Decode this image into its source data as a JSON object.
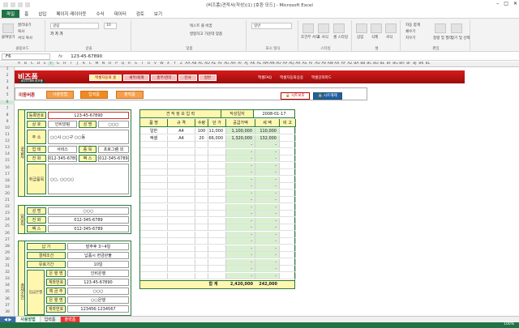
{
  "window": {
    "title": "(비즈폼)견적서(작성)(1) [호환 모드] - Microsoft Excel"
  },
  "ribbon_tabs": [
    "파일",
    "홈",
    "삽입",
    "페이지 레이아웃",
    "수식",
    "데이터",
    "검토",
    "보기"
  ],
  "ribbon": {
    "clipboard": {
      "paste": "붙여넣기",
      "cut": "잘라내기",
      "copy": "복사",
      "format_painter": "서식 복사",
      "label": "클립보드"
    },
    "font": {
      "font_name": "굴림",
      "font_size": "10",
      "label": "글꼴"
    },
    "alignment": {
      "wrap": "텍스트 줄 바꿈",
      "merge": "병합하고 가운데 맞춤",
      "label": "맞춤"
    },
    "number": {
      "format": "일반",
      "label": "표시 형식"
    },
    "styles": {
      "cond": "조건부 서식",
      "table": "표 서식",
      "cell": "셀 스타일",
      "label": "스타일"
    },
    "cells": {
      "insert": "삽입",
      "delete": "삭제",
      "format": "서식",
      "label": "셀"
    },
    "editing": {
      "autosum": "자동 합계",
      "fill": "채우기",
      "clear": "지우기",
      "sort": "정렬 및 필터",
      "find": "찾기 및 선택",
      "label": "편집"
    }
  },
  "formula_bar": {
    "name_box": "F6",
    "fx": "fx",
    "value": "123-45-67890"
  },
  "columns": [
    "A",
    "B",
    "C",
    "D",
    "E",
    "F",
    "G",
    "H",
    "I",
    "J",
    "K",
    "L",
    "M",
    "N",
    "O",
    "P",
    "Q",
    "R",
    "S",
    "T",
    "U",
    "V",
    "W",
    "X",
    "Y",
    "Z",
    "AA",
    "AB",
    "AC",
    "AD",
    "AE",
    "AF",
    "AG",
    "AH",
    "AI",
    "AJ",
    "AK",
    "AL",
    "AM",
    "AN",
    "AO",
    "AP",
    "AQ",
    "AR",
    "AS",
    "AT",
    "AU",
    "AV",
    "AW",
    "AX",
    "AY",
    "AZ",
    "BA",
    "BB",
    "BC",
    "BD",
    "BE",
    "BF",
    "BG",
    "BH",
    "BI",
    "BJ",
    "BK",
    "BL"
  ],
  "rows": [
    "1",
    "2",
    "3",
    "4",
    "5",
    "6",
    "7",
    "8",
    "9",
    "10",
    "11",
    "12",
    "13",
    "14",
    "15",
    "16",
    "17",
    "18",
    "19",
    "20",
    "21",
    "22",
    "23",
    "24",
    "25",
    "26",
    "27",
    "28",
    "29",
    "30",
    "31",
    "32",
    "33",
    "34",
    "35",
    "36",
    "37",
    "38"
  ],
  "banner": {
    "logo": "비즈폼",
    "sub": "BIZFORM 비즈폼",
    "nav": [
      "엑셀자동화 홈",
      "세무/회계",
      "총무/관리",
      "인사",
      "일반"
    ],
    "links": [
      "엑셀FAQ",
      "엑셀자동화응용",
      "엑셀강좌파드"
    ]
  },
  "toolbar": {
    "title": "이동버튼",
    "buttons": [
      "사용방법",
      "입력폼",
      "출력폼"
    ],
    "print_preview": "시트보호",
    "unprotect": "시트해제"
  },
  "supplier": {
    "section": "공급자",
    "reg_label": "등록번호",
    "reg_value": "123-45-67890",
    "company_label": "상 호",
    "company_value": "인비앙텀",
    "name_label": "성 명",
    "name_value": "○○○",
    "address_label": "주 소",
    "address_value": "○○시 ○○구 ○○동",
    "biz_label": "업 태",
    "biz_value": "서비스",
    "item_label": "종 목",
    "item_value": "프로그램 외",
    "tel_label": "전 화",
    "tel_value": "012-345-6789",
    "fax_label": "팩 스",
    "fax_value": "012-345-6789",
    "manager_label": "취급품목",
    "manager_value": "○○, ○○○○"
  },
  "recipient": {
    "section": "담당자",
    "name_label": "성 명",
    "name_value": "○○○",
    "tel_label": "전 화",
    "tel_value": "012-345-6789",
    "fax_label": "팩 스",
    "fax_value": "012-345-6789"
  },
  "terms": {
    "section": "결제조건",
    "rows": [
      {
        "label": "납 기",
        "value": "발주후 3~4일"
      },
      {
        "label": "결제조건",
        "value": "납품시 현금완불"
      },
      {
        "label": "유효기간",
        "value": "10일"
      },
      {
        "label": "은 행 명",
        "value": "인비은행"
      },
      {
        "label": "계좌번호",
        "value": "123-45-67890"
      },
      {
        "label": "예 금 주",
        "value": "○○○"
      },
      {
        "label": "은 행 명",
        "value": "○○은행"
      },
      {
        "label": "계좌번호",
        "value": "123456-1234567"
      }
    ],
    "bank_section": "입금은행"
  },
  "quote": {
    "title": "견 적 정 보 입 력",
    "date_label": "작성일자",
    "date_value": "2008-01-17",
    "headers": [
      "품 명",
      "규 격",
      "수량",
      "단 가",
      "공급가액",
      "세 액",
      "비 고"
    ],
    "items": [
      {
        "name": "일반",
        "spec": "A4",
        "qty": "100",
        "price": "11,000",
        "supply": "1,100,000",
        "tax": "110,000",
        "note": ""
      },
      {
        "name": "엑셀",
        "spec": "A4",
        "qty": "20",
        "price": "66,000",
        "supply": "1,320,000",
        "tax": "132,000",
        "note": ""
      }
    ],
    "empty_dash": "-",
    "total_label": "합 계",
    "total_supply": "2,420,000",
    "total_tax": "242,000"
  },
  "sheet_tabs": [
    "사용방법",
    "입력폼",
    "출력폼"
  ],
  "status": {
    "zoom": "100%"
  }
}
